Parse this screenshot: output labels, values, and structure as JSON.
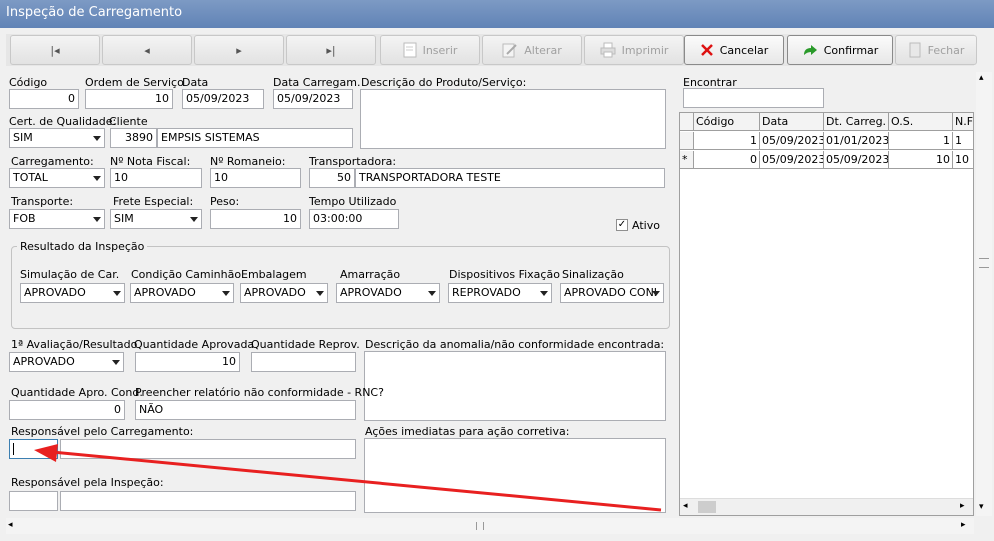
{
  "window": {
    "title": "Inspeção de Carregamento"
  },
  "toolbar": {
    "nav_first": "|◂",
    "nav_prev": "◂",
    "nav_next": "▸",
    "nav_last": "▸|",
    "insert": "Inserir",
    "edit": "Alterar",
    "print": "Imprimir",
    "cancel": "Cancelar",
    "confirm": "Confirmar",
    "close": "Fechar"
  },
  "form": {
    "codigo": {
      "label": "Código",
      "value": "0"
    },
    "ordem": {
      "label": "Ordem de Serviço",
      "value": "10"
    },
    "data": {
      "label": "Data",
      "value": "05/09/2023"
    },
    "data_carreg": {
      "label": "Data Carregam.",
      "value": "05/09/2023"
    },
    "descricao": {
      "label": "Descrição do Produto/Serviço:",
      "value": ""
    },
    "cert": {
      "label": "Cert. de Qualidade:",
      "value": "SIM"
    },
    "cliente": {
      "label": "Cliente",
      "code": "3890",
      "name": "EMPSIS SISTEMAS"
    },
    "carregamento": {
      "label": "Carregamento:",
      "value": "TOTAL"
    },
    "nota": {
      "label": "Nº Nota Fiscal:",
      "value": "10"
    },
    "romaneio": {
      "label": "Nº Romaneio:",
      "value": "10"
    },
    "transportadora": {
      "label": "Transportadora:",
      "code": "50",
      "name": "TRANSPORTADORA TESTE"
    },
    "transporte": {
      "label": "Transporte:",
      "value": "FOB"
    },
    "frete": {
      "label": "Frete Especial:",
      "value": "SIM"
    },
    "peso": {
      "label": "Peso:",
      "value": "10"
    },
    "tempo": {
      "label": "Tempo Utilizado",
      "value": "03:00:00"
    },
    "ativo": {
      "label": "Ativo",
      "checked": "✓"
    }
  },
  "resultado": {
    "title": "Resultado da Inspeção",
    "simulacao": {
      "label": "Simulação de Car.",
      "value": "APROVADO"
    },
    "condicao": {
      "label": "Condição Caminhão",
      "value": "APROVADO"
    },
    "embalagem": {
      "label": "Embalagem",
      "value": "APROVADO"
    },
    "amarracao": {
      "label": "Amarração",
      "value": "APROVADO"
    },
    "dispositivos": {
      "label": "Dispositivos Fixação",
      "value": "REPROVADO"
    },
    "sinalizacao": {
      "label": "Sinalização",
      "value": "APROVADO CONI"
    }
  },
  "avaliacao": {
    "primeira": {
      "label": "1ª Avaliação/Resultado",
      "value": "APROVADO"
    },
    "qtd_aprovada": {
      "label": "Quantidade Aprovada",
      "value": "10"
    },
    "qtd_reprov": {
      "label": "Quantidade Reprov.",
      "value": ""
    },
    "anomalia": {
      "label": "Descrição da anomalia/não conformidade encontrada:",
      "value": ""
    },
    "qtd_cond": {
      "label": "Quantidade Apro. Cond.",
      "value": "0"
    },
    "rnc": {
      "label": "Preencher relatório não conformidade - RNC?",
      "value": "NÃO"
    },
    "resp_carreg": {
      "label": "Responsável pelo Carregamento:",
      "code": "",
      "name": ""
    },
    "acoes": {
      "label": "Ações imediatas para ação corretiva:",
      "value": ""
    },
    "resp_insp": {
      "label": "Responsável pela Inspeção:",
      "code": "",
      "name": ""
    }
  },
  "search": {
    "label": "Encontrar",
    "value": ""
  },
  "grid": {
    "columns": [
      "Código",
      "Data",
      "Dt. Carreg.",
      "O.S.",
      "N.F"
    ],
    "rows": [
      {
        "indicator": "",
        "cells": [
          "1",
          "05/09/2023",
          "01/01/2023",
          "1",
          "1"
        ]
      },
      {
        "indicator": "*",
        "cells": [
          "0",
          "05/09/2023",
          "05/09/2023",
          "10",
          "10"
        ]
      }
    ]
  },
  "annotation": {
    "color": "#e82020"
  }
}
